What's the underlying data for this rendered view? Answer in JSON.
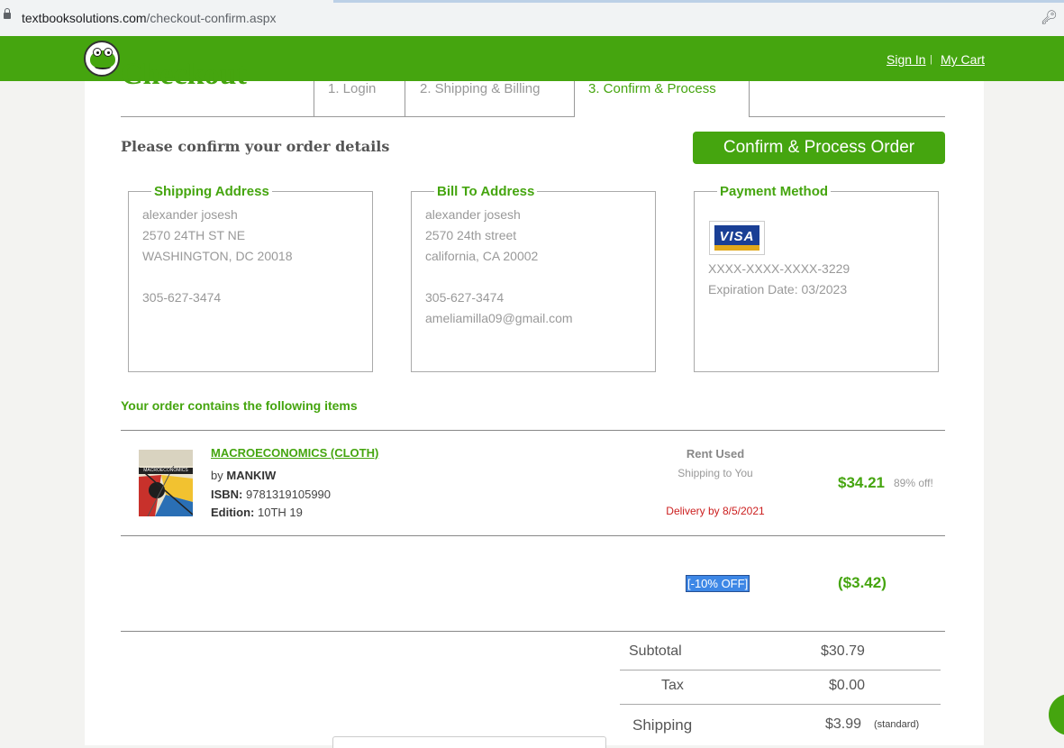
{
  "browser": {
    "url_host": "textbooksolutions.com",
    "url_path": "/checkout-confirm.aspx"
  },
  "header": {
    "sign_in": "Sign In",
    "separator": "|",
    "my_cart": "My Cart",
    "brand_color": "#45a50f"
  },
  "checkout": {
    "title": "Checkout",
    "steps": [
      "1. Login",
      "2. Shipping & Billing",
      "3. Confirm & Process"
    ],
    "active_step": 3,
    "heading": "Please confirm your order details",
    "confirm_button": "Confirm & Process Order"
  },
  "shipping": {
    "legend": "Shipping Address",
    "lines": [
      "alexander josesh",
      "2570 24TH ST NE",
      "WASHINGTON, DC  20018",
      "",
      "305-627-3474"
    ]
  },
  "billing": {
    "legend": "Bill To Address",
    "lines": [
      "alexander josesh",
      "2570 24th street",
      "california, CA  20002",
      "",
      "305-627-3474",
      "ameliamilla09@gmail.com"
    ]
  },
  "payment": {
    "legend": "Payment Method",
    "card_brand": "VISA",
    "card_number": "XXXX-XXXX-XXXX-3229",
    "expiration": "Expiration Date: 03/2023"
  },
  "items": {
    "heading": "Your order contains the following items",
    "list": [
      {
        "thumb_title": "MACROECONOMICS",
        "title": "MACROECONOMICS (CLOTH)",
        "by_label": "by",
        "author": "MANKIW",
        "isbn_label": "ISBN:",
        "isbn": "9781319105990",
        "edition_label": "Edition:",
        "edition": "10TH 19",
        "rent_type": "Rent Used",
        "shipping": "Shipping to You",
        "delivery": "Delivery by 8/5/2021",
        "price": "$34.21",
        "discount": "89% off!"
      }
    ],
    "promo_label": "[-10% OFF]",
    "promo_amount": "($3.42)"
  },
  "summary": {
    "subtotal_label": "Subtotal",
    "subtotal": "$30.79",
    "tax_label": "Tax",
    "tax": "$0.00",
    "shipping_label": "Shipping",
    "shipping": "$3.99",
    "shipping_method": "(standard)"
  }
}
